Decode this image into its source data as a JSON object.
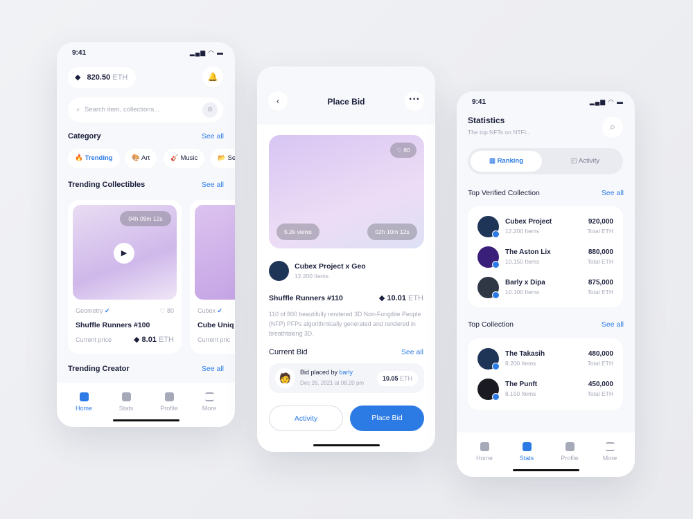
{
  "status": {
    "time": "9:41"
  },
  "home": {
    "balance": "820.50",
    "currency": "ETH",
    "search_placeholder": "Search item, collections...",
    "category": {
      "title": "Category",
      "see_all": "See all",
      "chips": [
        {
          "icon": "🔥",
          "label": "Trending"
        },
        {
          "icon": "🎨",
          "label": "Art"
        },
        {
          "icon": "🎸",
          "label": "Music"
        },
        {
          "icon": "📂",
          "label": "Se"
        }
      ]
    },
    "collectibles": {
      "title": "Trending Collectibles",
      "see_all": "See all",
      "cards": [
        {
          "timer": "04h 09m 12s",
          "creator": "Geometry",
          "likes": "80",
          "name": "Shuffle Runners #100",
          "price_label": "Current price",
          "price": "8.01",
          "currency": "ETH"
        },
        {
          "creator": "Cubex",
          "name": "Cube Uniq",
          "price_label": "Current pric"
        }
      ]
    },
    "creator": {
      "title": "Trending Creator",
      "see_all": "See all"
    },
    "nav": [
      "Home",
      "Stats",
      "Profile",
      "More"
    ]
  },
  "bid": {
    "title": "Place Bid",
    "likes": "80",
    "views": "5.2k views",
    "timer": "02h 10m 12s",
    "collection": "Cubex Project x Geo",
    "items": "12.200 Items",
    "name": "Shuffle Runners #110",
    "price": "10.01",
    "currency": "ETH",
    "description": "110 of 800 beautifully rendered 3D Non-Fungible People (NFP) PFPs algorithmically generated and rendered in breathtaking 3D.",
    "current_bid": {
      "title": "Current Bid",
      "see_all": "See all",
      "prefix": "Bid placed by ",
      "user": "barly",
      "date": "Dec 26, 2021 at 08.20 pm",
      "amount": "10.05",
      "currency": "ETH"
    },
    "activity_label": "Activity",
    "place_bid_label": "Place Bid"
  },
  "stats": {
    "title": "Statistics",
    "subtitle": "The top NFTs on NTFL.",
    "tabs": [
      "Ranking",
      "Activity"
    ],
    "verified": {
      "title": "Top Verified Collection",
      "see_all": "See all",
      "rows": [
        {
          "name": "Cubex Project",
          "items": "12.200 Items",
          "value": "920,000",
          "unit": "Total ETH",
          "color": "#1f3558"
        },
        {
          "name": "The Aston Lix",
          "items": "10.150 Items",
          "value": "880,000",
          "unit": "Total ETH",
          "color": "#3a1f7a"
        },
        {
          "name": "Barly x Dipa",
          "items": "10.100 Items",
          "value": "875,000",
          "unit": "Total ETH",
          "color": "#2f3745"
        }
      ]
    },
    "top": {
      "title": "Top Collection",
      "see_all": "See all",
      "rows": [
        {
          "name": "The Takasih",
          "items": "8.200 Items",
          "value": "480,000",
          "unit": "Total ETH",
          "color": "#1f3558"
        },
        {
          "name": "The Punft",
          "items": "8.150 Items",
          "value": "450,000",
          "unit": "Total ETH",
          "color": "#1a1a22"
        }
      ]
    },
    "nav": [
      "Home",
      "Stats",
      "Profile",
      "More"
    ]
  },
  "colors": {
    "accent": "#2c7be5",
    "text": "#1b1f3b",
    "muted": "#a5a9b8"
  }
}
